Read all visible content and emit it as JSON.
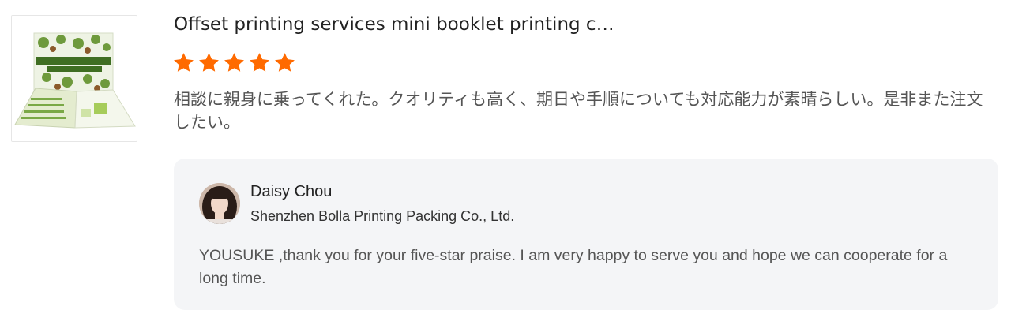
{
  "review": {
    "product_title": "Offset printing services mini booklet printing c…",
    "rating": 5,
    "rating_max": 5,
    "star_color": "#ff6a00",
    "comment": "相談に親身に乗ってくれた。クオリティも高く、期日や手順についても対応能力が素晴らしい。是非また注文したい。",
    "thumbnail_icon": "product-thumbnail"
  },
  "reply": {
    "author_name": "Daisy Chou",
    "company": "Shenzhen Bolla Printing Packing Co., Ltd.",
    "text": "YOUSUKE ,thank you for your five-star praise. I am very happy to serve you and hope we can cooperate for a long time.",
    "avatar_icon": "avatar-photo"
  }
}
